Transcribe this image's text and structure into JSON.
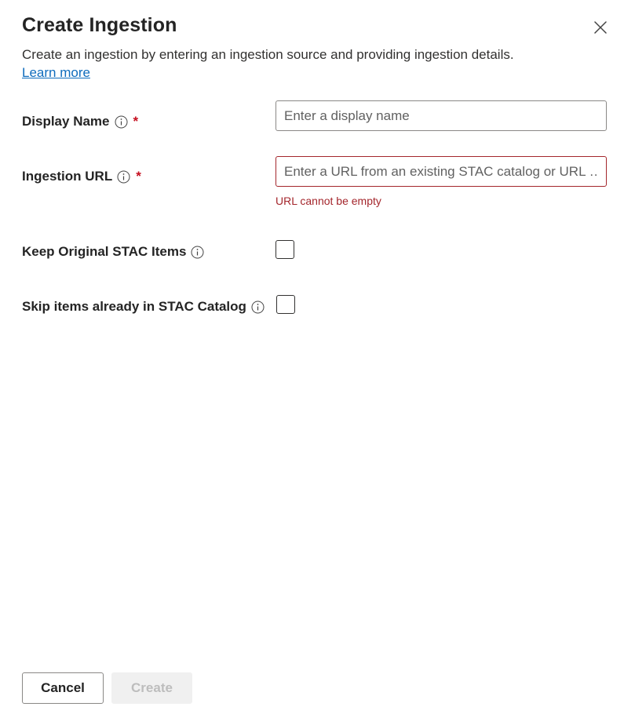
{
  "dialog": {
    "title": "Create Ingestion",
    "description": "Create an ingestion by entering an ingestion source and providing ingestion details.",
    "learn_more": "Learn more",
    "close_icon": "close-icon"
  },
  "fields": {
    "display_name": {
      "label": "Display Name",
      "required_mark": "*",
      "value": "",
      "placeholder": "Enter a display name",
      "info_icon": "info-icon"
    },
    "ingestion_url": {
      "label": "Ingestion URL",
      "required_mark": "*",
      "value": "",
      "placeholder": "Enter a URL from an existing STAC catalog or URL …",
      "error": "URL cannot be empty",
      "info_icon": "info-icon"
    },
    "keep_original": {
      "label": "Keep Original STAC Items",
      "checked": false,
      "info_icon": "info-icon"
    },
    "skip_existing": {
      "label": "Skip items already in STAC Catalog",
      "checked": false,
      "info_icon": "info-icon"
    }
  },
  "footer": {
    "cancel_label": "Cancel",
    "create_label": "Create",
    "create_disabled": true
  },
  "colors": {
    "accent_link": "#0f6cbd",
    "error": "#a4262c",
    "required": "#c50f1f",
    "disabled_bg": "#f0f0f0",
    "disabled_text": "#bdbdbd"
  }
}
